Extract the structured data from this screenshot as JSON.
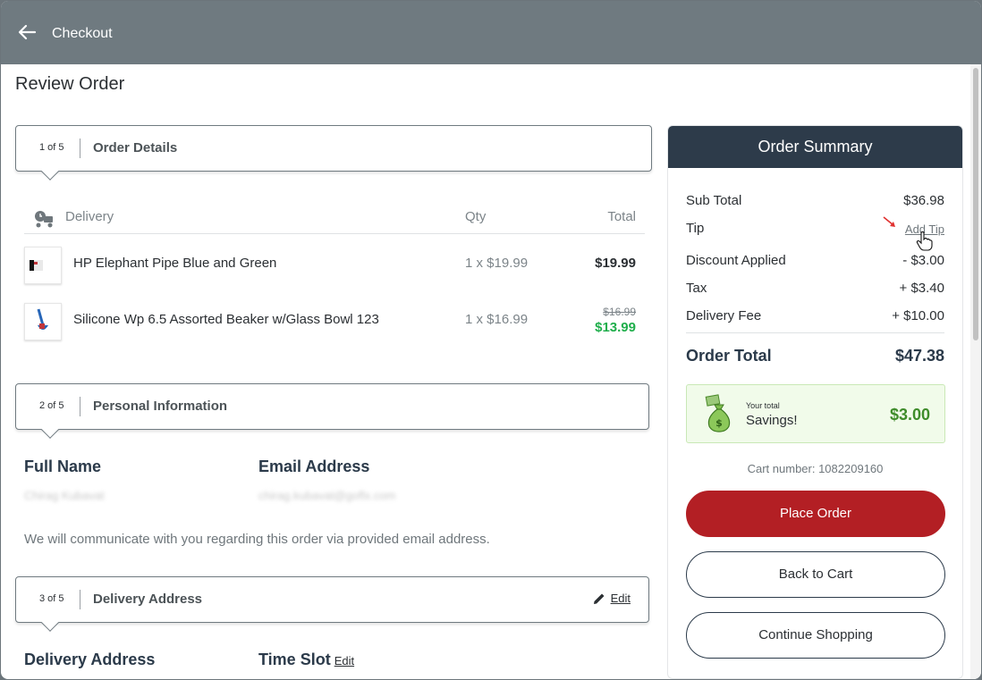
{
  "topbar": {
    "title": "Checkout"
  },
  "page": {
    "title": "Review Order"
  },
  "steps": [
    {
      "num": "1 of 5",
      "title": "Order Details"
    },
    {
      "num": "2 of 5",
      "title": "Personal Information"
    },
    {
      "num": "3 of 5",
      "title": "Delivery Address",
      "edit": "Edit"
    }
  ],
  "order_table": {
    "headers": {
      "item": "Delivery",
      "qty": "Qty",
      "total": "Total"
    },
    "rows": [
      {
        "name": "HP Elephant Pipe Blue and Green",
        "qty": "1 x $19.99",
        "total": "$19.99"
      },
      {
        "name": "Silicone Wp 6.5 Assorted Beaker w/Glass Bowl 123",
        "qty": "1 x $16.99",
        "original": "$16.99",
        "total": "$13.99"
      }
    ]
  },
  "personal": {
    "full_name_label": "Full Name",
    "email_label": "Email Address",
    "full_name_value": "Chirag Kubavat",
    "email_value": "chirag.kubavat@goflx.com",
    "note": "We will communicate with you regarding this order via provided email address."
  },
  "delivery": {
    "address_label": "Delivery Address",
    "timeslot_label": "Time Slot",
    "timeslot_edit": "Edit"
  },
  "summary": {
    "title": "Order Summary",
    "lines": [
      {
        "label": "Sub Total",
        "value": "$36.98"
      },
      {
        "label": "Tip",
        "value": "Add Tip"
      },
      {
        "label": "Discount Applied",
        "value": "- $3.00"
      },
      {
        "label": "Tax",
        "value": "+ $3.40"
      },
      {
        "label": "Delivery Fee",
        "value": "+ $10.00"
      }
    ],
    "total_label": "Order Total",
    "total_value": "$47.38",
    "savings_small": "Your total",
    "savings_label": "Savings!",
    "savings_value": "$3.00",
    "cart_number": "Cart number: 1082209160",
    "place_order": "Place Order",
    "back_to_cart": "Back to Cart",
    "continue_shopping": "Continue Shopping"
  },
  "colors": {
    "topbar": "#6f7a80",
    "summary_header": "#2d3b4a",
    "primary_button": "#b31f24",
    "sale_price": "#1fae4b",
    "savings_value": "#3e8c2a"
  },
  "icons": [
    "back-arrow-icon",
    "delivery-truck-icon",
    "pencil-icon",
    "money-bag-icon",
    "red-arrow-icon",
    "hand-cursor-icon"
  ]
}
